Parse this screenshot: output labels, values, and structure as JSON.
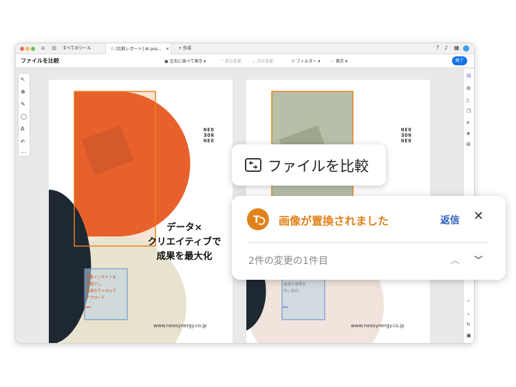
{
  "tabs": [
    {
      "label": "すべてのツール"
    },
    {
      "label": "[比較レポート] AI pos..."
    },
    {
      "label": "作成"
    }
  ],
  "toolbar": {
    "doc_title": "ファイルを比較",
    "side_by_side": "左右に並べて表示",
    "prev_change": "前の変更",
    "next_change": "次の変更",
    "filter": "フィルター",
    "view": "表示",
    "finish": "終了"
  },
  "pages": {
    "brand": "NEO\nƎON\nNEO",
    "tagline_left": "データ×\nクリエイティブで\n成果を最大化",
    "body_left": "顧客インサイトを\n深掘りし、\n最適なチャネルで\nアプローチ",
    "body_right": "ーズを可視化\n最適な施策を\n的に設計。",
    "url": "www.neosynergy.co.jp"
  },
  "popup_compare": {
    "label": "ファイルを比較",
    "icon": "compare-files-icon"
  },
  "popup_change": {
    "title": "画像が置換されました",
    "reply": "返信",
    "count": "2件の変更の1件目",
    "icon": "image-replace-icon"
  },
  "colors": {
    "accent_orange": "#e0821a",
    "link_blue": "#2a5bb8",
    "button_blue": "#1473e6",
    "orange_shape": "#e8612b",
    "beige_shape": "#e8e3cf",
    "navy_shape": "#1e2833",
    "sage_photo": "#b8bfa8",
    "pink_shape": "#f0e4dc"
  }
}
